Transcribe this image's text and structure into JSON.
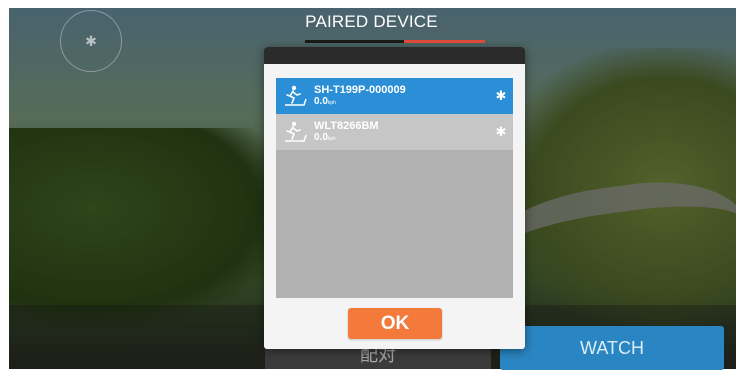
{
  "header": {
    "title": "PAIRED DEVICE"
  },
  "background": {
    "bluetooth_icon": "bluetooth-icon"
  },
  "dialog": {
    "devices": [
      {
        "name": "SH-T199P-000009",
        "speed": "0.0",
        "unit": "kph",
        "selected": true,
        "icon": "treadmill-icon"
      },
      {
        "name": "WLT8266BM",
        "speed": "0.0",
        "unit": "kph",
        "selected": false,
        "icon": "treadmill-icon"
      }
    ],
    "ok_label": "OK"
  },
  "footer": {
    "left_button_label": "配对",
    "watch_button_label": "WATCH"
  },
  "colors": {
    "selected_row": "#2a8fd6",
    "ok_button": "#f37a3b",
    "watch_button": "#2a86c2"
  }
}
